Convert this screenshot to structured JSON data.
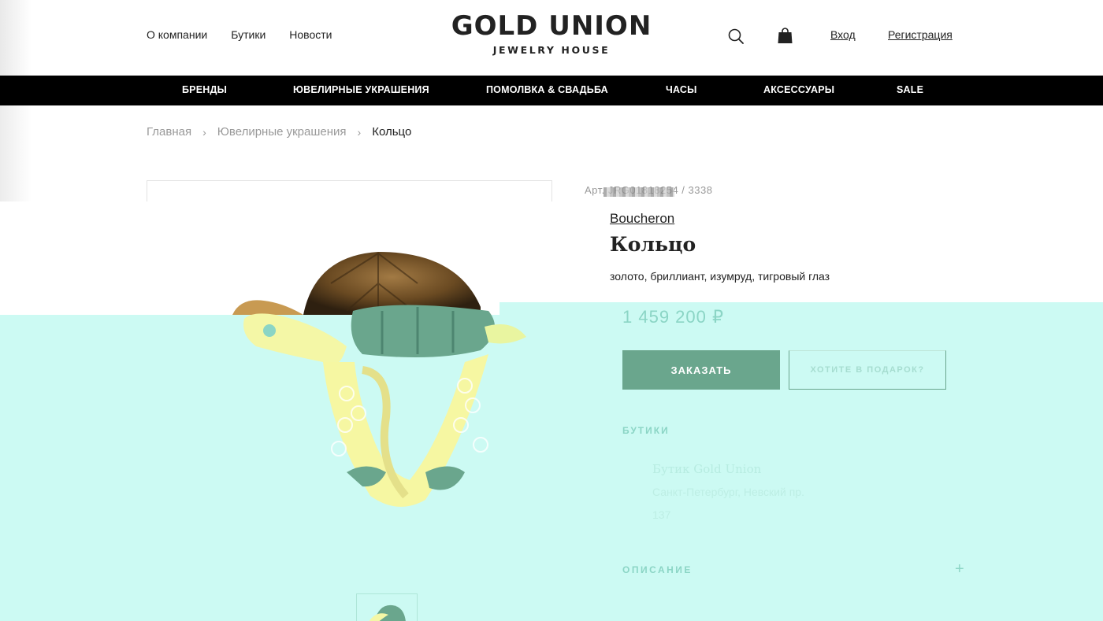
{
  "header": {
    "nav": [
      "О компании",
      "Бутики",
      "Новости"
    ],
    "logo_main": "GOLD UNION",
    "logo_sub": "JEWELRY HOUSE",
    "login": "Вход",
    "register": "Регистрация"
  },
  "categories": [
    "БРЕНДЫ",
    "ЮВЕЛИРНЫЕ УКРАШЕНИЯ",
    "ПОМОЛВКА & СВАДЬБА",
    "ЧАСЫ",
    "АКСЕССУАРЫ",
    "SALE"
  ],
  "breadcrumb": {
    "home": "Главная",
    "section": "Ювелирные украшения",
    "current": "Кольцо"
  },
  "product": {
    "article": "Арт. JRG01818254 / 3338",
    "brand": "Boucheron",
    "title": "Кольцо",
    "materials": "золото, бриллиант, изумруд, тигровый глаз",
    "price": "1 459 200 ₽",
    "order_label": "ЗАКАЗАТЬ",
    "gift_label": "ХОТИТЕ В ПОДАРОК?"
  },
  "boutiques": {
    "title": "БУТИКИ",
    "name": "Бутик Gold Union",
    "address": "Санкт-Петербург, Невский пр.",
    "number": "137"
  },
  "description": {
    "title": "ОПИСАНИЕ",
    "toggle": "+"
  },
  "colors": {
    "mint_background": "#ccfaf3",
    "accent_green": "#6aa68d",
    "category_bar": "#000000"
  },
  "icons": [
    "search-icon",
    "shopping-bag-icon",
    "chevron-right-icon",
    "plus-icon"
  ]
}
